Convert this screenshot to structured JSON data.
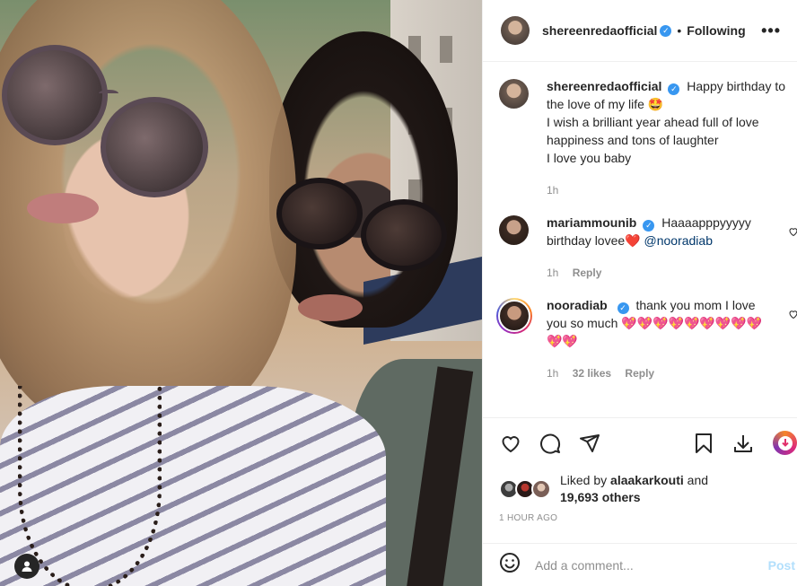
{
  "post": {
    "image_alt": "",
    "header": {
      "username": "shereenredaofficial",
      "separator": "•",
      "follow_status": "Following",
      "more_label": "•••"
    },
    "caption": {
      "username": "shereenredaofficial",
      "text_line1": "Happy birthday to the love of my life",
      "emoji": "🤩",
      "text_line2": "I wish a brilliant year ahead full of love happiness and tons of laughter",
      "text_line3": "I love you baby",
      "time": "1h"
    },
    "comments": [
      {
        "username": "mariammounib",
        "text": "Haaaapppyyyyy birthday lovee",
        "emoji": "❤️",
        "mention": "@nooradiab",
        "time": "1h",
        "reply_label": "Reply"
      },
      {
        "username": "nooradiab",
        "text": "thank you mom I love you so much",
        "emoji": "💖💖💖💖💖💖💖💖💖💖💖",
        "time": "1h",
        "likes": "32 likes",
        "reply_label": "Reply"
      }
    ],
    "likes": {
      "liked_by_prefix": "Liked by",
      "liked_by_user": "alaakarkouti",
      "and_label": "and",
      "others": "19,693 others"
    },
    "timestamp": "1 HOUR AGO",
    "add_comment": {
      "placeholder": "Add a comment...",
      "post_label": "Post"
    }
  },
  "colors": {
    "verified": "#3897f0",
    "link_blue": "#00376b",
    "post_disabled": "#b2dffc",
    "muted": "#8e8e8e",
    "text": "#262626"
  },
  "icons": [
    "heart-icon",
    "comment-icon",
    "share-icon",
    "bookmark-icon",
    "download-icon",
    "emoji-icon",
    "user-tag-icon",
    "verified-icon",
    "more-icon"
  ]
}
